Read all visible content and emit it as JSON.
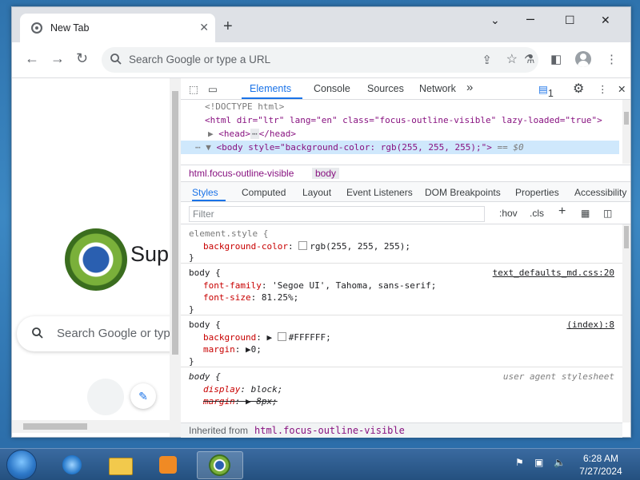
{
  "browser": {
    "tab_title": "New Tab",
    "new_tab_symbol": "+",
    "omnibox_placeholder": "Search Google or type a URL"
  },
  "new_tab_page": {
    "brand_text": "Supe",
    "search_placeholder": "Search Google or type a URL"
  },
  "devtools": {
    "panels": [
      "Elements",
      "Console",
      "Sources",
      "Network"
    ],
    "more_panels": "»",
    "issues_count": "1",
    "dom": {
      "doctype": "<!DOCTYPE html>",
      "html_open": "<html dir=\"ltr\" lang=\"en\" class=\"focus-outline-visible\" lazy-loaded=\"true\">",
      "head_line": "<head>",
      "head_close": "</head>",
      "body_line": "<body style=\"background-color: rgb(255, 255, 255);\">",
      "body_suffix": "== $0"
    },
    "breadcrumbs": [
      "html.focus-outline-visible",
      "body"
    ],
    "subtabs": [
      "Styles",
      "Computed",
      "Layout",
      "Event Listeners",
      "DOM Breakpoints",
      "Properties",
      "Accessibility"
    ],
    "filter_placeholder": "Filter",
    "filter_options": [
      ":hov",
      ".cls"
    ],
    "rules": {
      "element_style": {
        "selector": "element.style {",
        "prop": "background-color",
        "value": "rgb(255, 255, 255);",
        "close": "}"
      },
      "body1": {
        "selector": "body {",
        "source": "text_defaults_md.css:20",
        "prop1": "font-family",
        "value1": "'Segoe UI', Tahoma, sans-serif;",
        "prop2": "font-size",
        "value2": "81.25%;",
        "close": "}"
      },
      "body2": {
        "selector": "body {",
        "source": "(index):8",
        "prop1": "background",
        "value1": "#FFFFFF;",
        "prop2": "margin",
        "value2": "0;",
        "close": "}"
      },
      "body3": {
        "selector": "body {",
        "source": "user agent stylesheet",
        "prop1": "display",
        "value1": "block;",
        "prop2": "margin",
        "value2": "8px;"
      }
    },
    "inherited_label": "Inherited from",
    "inherited_selector": "html.focus-outline-visible"
  },
  "taskbar": {
    "time": "6:28 AM",
    "date": "7/27/2024"
  },
  "colors": {
    "accent": "#1a73e8",
    "tag": "#881280",
    "property": "#c80000",
    "selection": "#cfe8fc"
  }
}
